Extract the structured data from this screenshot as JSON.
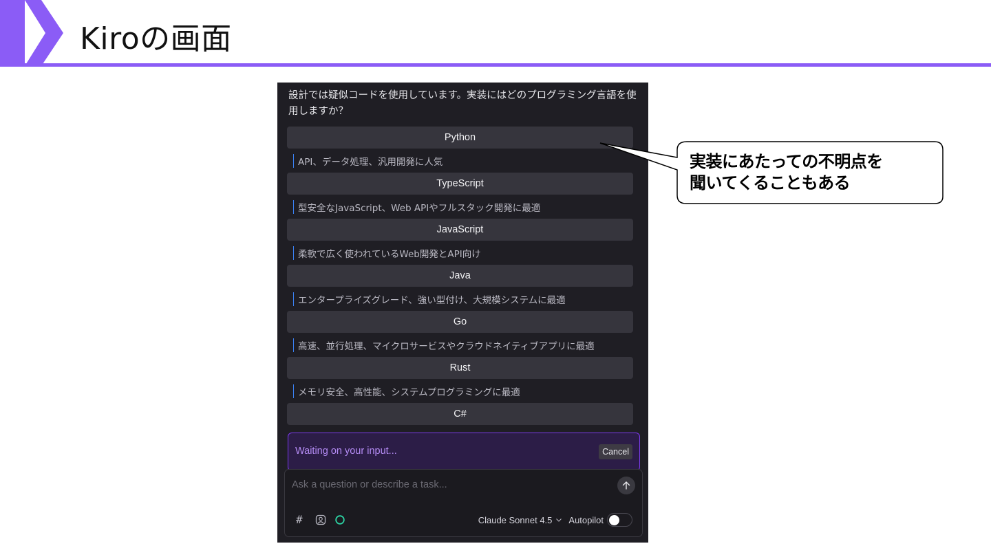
{
  "slide": {
    "title": "Kiroの画面",
    "accent_color": "#8b5cf6"
  },
  "kiro": {
    "question": "設計では疑似コードを使用しています。実装にはどのプログラミング言語を使用しますか？",
    "options": [
      {
        "label": "Python",
        "description": "API、データ処理、汎用開発に人気"
      },
      {
        "label": "TypeScript",
        "description": "型安全なJavaScript、Web APIやフルスタック開発に最適"
      },
      {
        "label": "JavaScript",
        "description": "柔軟で広く使われているWeb開発とAPI向け"
      },
      {
        "label": "Java",
        "description": "エンタープライズグレード、強い型付け、大規模システムに最適"
      },
      {
        "label": "Go",
        "description": "高速、並行処理、マイクロサービスやクラウドネイティブアプリに最適"
      },
      {
        "label": "Rust",
        "description": "メモリ安全、高性能、システムプログラミングに最適"
      },
      {
        "label": "C#",
        "description": ""
      }
    ],
    "waiting": {
      "text": "Waiting on your input...",
      "cancel_label": "Cancel"
    },
    "chat": {
      "placeholder": "Ask a question or describe a task...",
      "icons": [
        "hash-icon",
        "image-icon",
        "circle-icon",
        "send-arrow-icon"
      ],
      "model": "Claude Sonnet 4.5",
      "autopilot_label": "Autopilot",
      "autopilot_on": true
    },
    "colors": {
      "panel_bg": "#1f1e24",
      "option_bg": "#36353d",
      "waiting_accent": "#7c3aed",
      "status_circle": "#2dd4a4"
    }
  },
  "callout": {
    "lines": [
      "実装にあたっての不明点を",
      "聞いてくることもある"
    ]
  }
}
